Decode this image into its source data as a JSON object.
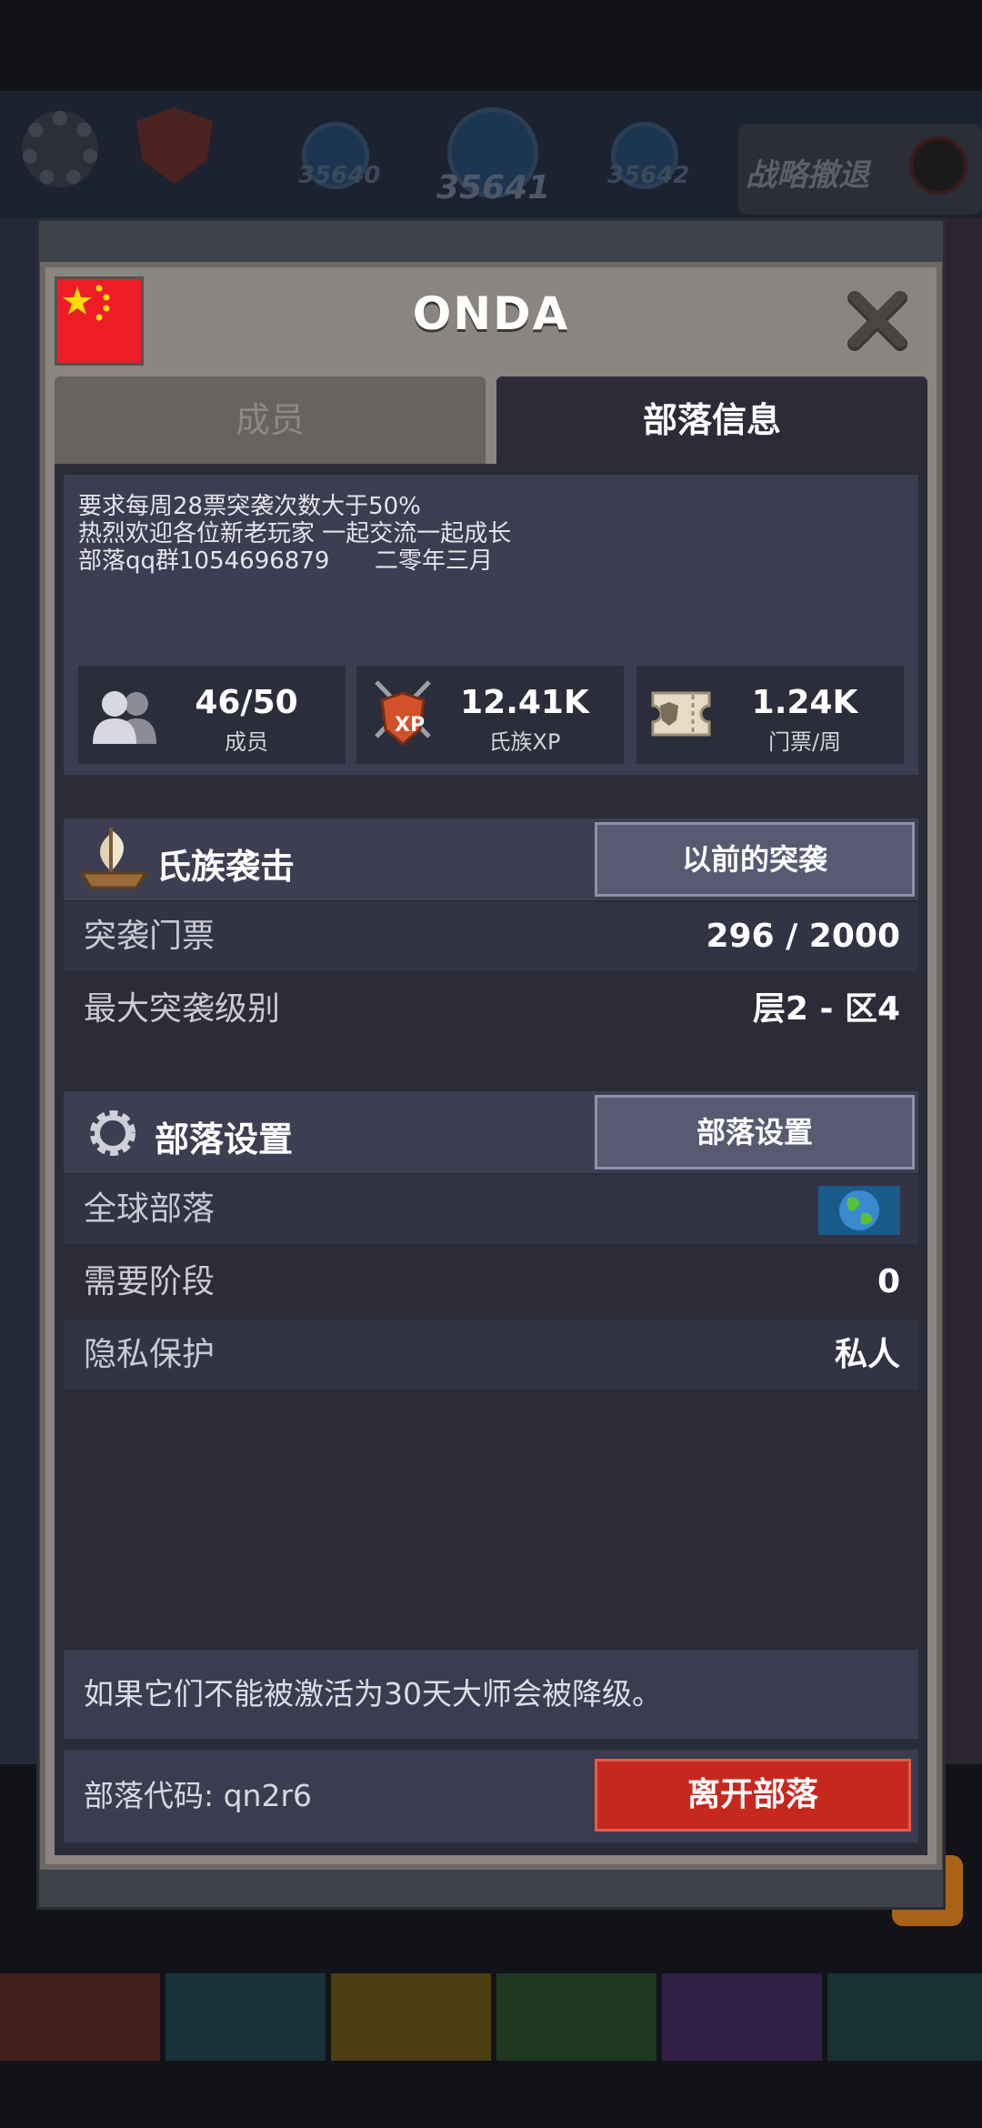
{
  "background": {
    "levels": [
      "35640",
      "35641",
      "35642"
    ],
    "retreat_label": "战略撤退",
    "help_glyph": "?"
  },
  "clan": {
    "name": "ONDA",
    "flag": "china-flag-icon"
  },
  "tabs": [
    {
      "label": "成员",
      "active": false
    },
    {
      "label": "部落信息",
      "active": true
    }
  ],
  "description": {
    "lines": [
      "要求每周28票突袭次数大于50%",
      "热烈欢迎各位新老玩家 一起交流一起成长",
      "部落qq群1054696879      二零年三月"
    ]
  },
  "stats": [
    {
      "value": "46/50",
      "label": "成员",
      "icon": "members-icon"
    },
    {
      "value": "12.41K",
      "label": "氏族XP",
      "icon": "xp-shield-icon"
    },
    {
      "value": "1.24K",
      "label": "门票/周",
      "icon": "ticket-icon"
    }
  ],
  "raid": {
    "title": "氏族袭击",
    "button": "以前的突袭",
    "rows": [
      {
        "label": "突袭门票",
        "value": "296 / 2000"
      },
      {
        "label": "最大突袭级别",
        "value": "层2 - 区4"
      }
    ]
  },
  "settings": {
    "title": "部落设置",
    "button": "部落设置",
    "rows": [
      {
        "label": "全球部落",
        "value": "",
        "icon": "globe-icon"
      },
      {
        "label": "需要阶段",
        "value": "0"
      },
      {
        "label": "隐私保护",
        "value": "私人"
      }
    ]
  },
  "notice": "如果它们不能被激活为30天大师会被降级。",
  "footer": {
    "clan_code": "部落代码: qn2r6",
    "leave_button": "离开部落"
  },
  "colors": {
    "accent_red": "#c7281e",
    "panel": "#2b2c38",
    "section_header": "#3d3e52"
  }
}
